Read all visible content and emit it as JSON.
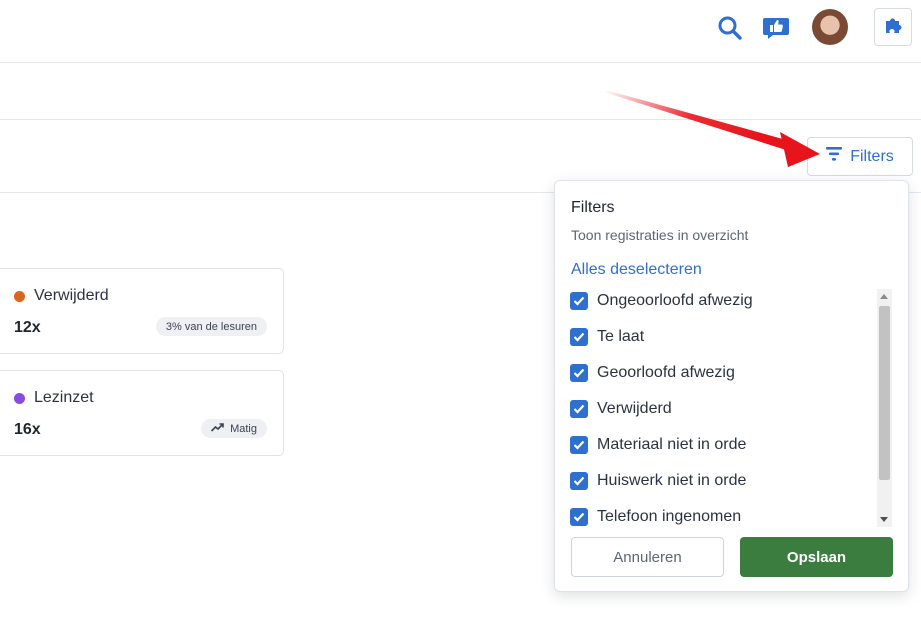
{
  "header": {
    "search_icon": "search-icon",
    "feedback_icon": "thumbs-up-icon",
    "settings_icon": "puzzle-icon"
  },
  "toolbar": {
    "filters_label": "Filters"
  },
  "cards": [
    {
      "label": "Verwijderd",
      "dot_color": "#d9661f",
      "count": "12x",
      "badge": "3% van de lesuren"
    },
    {
      "label": "Lezinzet",
      "dot_color": "#8a4be0",
      "count": "16x",
      "badge": "Matig"
    }
  ],
  "filters_popover": {
    "title": "Filters",
    "subtitle": "Toon registraties in overzicht",
    "deselect_all": "Alles deselecteren",
    "options": [
      {
        "label": "Ongeoorloofd afwezig",
        "checked": true
      },
      {
        "label": "Te laat",
        "checked": true
      },
      {
        "label": "Geoorloofd afwezig",
        "checked": true
      },
      {
        "label": "Verwijderd",
        "checked": true
      },
      {
        "label": "Materiaal niet in orde",
        "checked": true
      },
      {
        "label": "Huiswerk niet in orde",
        "checked": true
      },
      {
        "label": "Telefoon ingenomen",
        "checked": true
      }
    ],
    "cancel_label": "Annuleren",
    "save_label": "Opslaan"
  },
  "colors": {
    "accent": "#2e6fd0",
    "save": "#3a7d3f",
    "annotation_arrow": "#e8141b"
  }
}
